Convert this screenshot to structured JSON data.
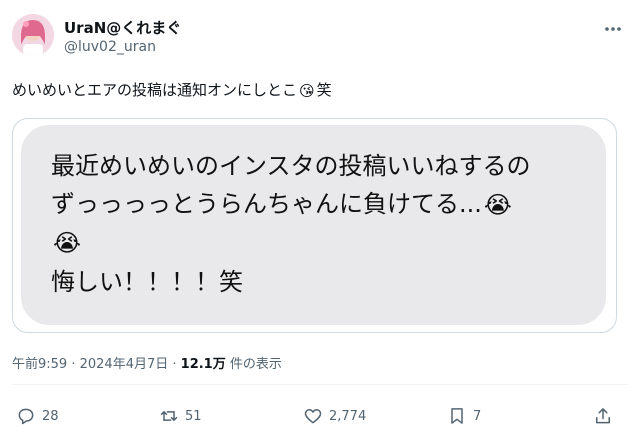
{
  "author": {
    "display_name": "UraN@くれまぐ",
    "handle": "@luv02_uran"
  },
  "tweet": {
    "text_before": "めいめいとエアの投稿は通知オンにしとこ",
    "emoji": "😘",
    "text_after": "笑"
  },
  "image": {
    "line1": "最近めいめいのインスタの投稿いいねするの",
    "line2": "ずっっっっとうらんちゃんに負けてる...",
    "line3": "",
    "line4": "悔しい！！！！笑",
    "emoji": "😭"
  },
  "meta": {
    "time": "午前9:59",
    "separator1": " · ",
    "date": "2024年4月7日",
    "separator2": " · ",
    "views": "12.1万",
    "views_suffix": " 件の表示"
  },
  "actions": {
    "reply_count": "28",
    "retweet_count": "51",
    "like_count": "2,774",
    "bookmark_count": "7"
  },
  "icons": {
    "more": "more-icon",
    "reply": "reply-icon",
    "retweet": "retweet-icon",
    "like": "heart-icon",
    "bookmark": "bookmark-icon",
    "share": "share-icon"
  }
}
